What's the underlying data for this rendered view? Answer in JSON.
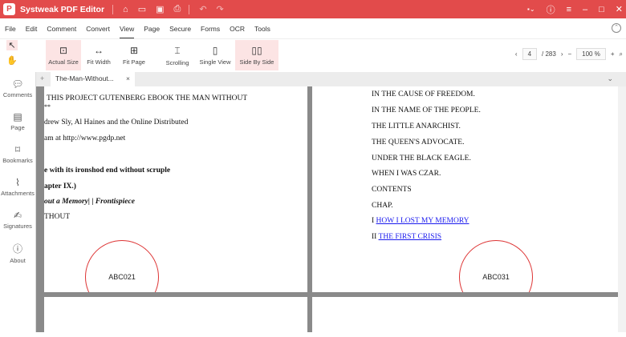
{
  "app": {
    "title": "Systweak PDF Editor"
  },
  "menu": [
    "File",
    "Edit",
    "Comment",
    "Convert",
    "View",
    "Page",
    "Secure",
    "Forms",
    "OCR",
    "Tools"
  ],
  "toolbar": {
    "items": [
      "Actual Size",
      "Fit Width",
      "Fit Page",
      "Scrolling",
      "Single View",
      "Side By Side"
    ]
  },
  "nav": {
    "page": "4",
    "total": "/ 283",
    "zoom": "100 %"
  },
  "sidebar": [
    "Comments",
    "Page",
    "Bookmarks",
    "Attachments",
    "Signatures",
    "About"
  ],
  "tab": {
    "label": "The-Man-Without...",
    "close": "×"
  },
  "left_page": {
    "lines": [
      "THIS PROJECT GUTENBERG EBOOK THE MAN WITHOUT",
      "**",
      "drew Sly, Al Haines and the Online Distributed",
      "am at http://www.pgdp.net",
      "e with its ironshod end without scruple",
      "apter IX.)",
      "out a Memory| | Frontispiece",
      "THOUT"
    ],
    "stamp": "ABC021"
  },
  "right_page": {
    "lines": [
      "IN THE CAUSE OF FREEDOM.",
      "IN THE NAME OF THE PEOPLE.",
      "THE LITTLE ANARCHIST.",
      "THE QUEEN'S ADVOCATE.",
      "UNDER THE BLACK EAGLE.",
      "WHEN I WAS CZAR.",
      "CONTENTS",
      "CHAP."
    ],
    "toc": [
      {
        "num": "I",
        "link": "HOW I LOST MY MEMORY"
      },
      {
        "num": "II",
        "link": "THE FIRST CRISIS"
      }
    ],
    "stamp": "ABC031"
  }
}
